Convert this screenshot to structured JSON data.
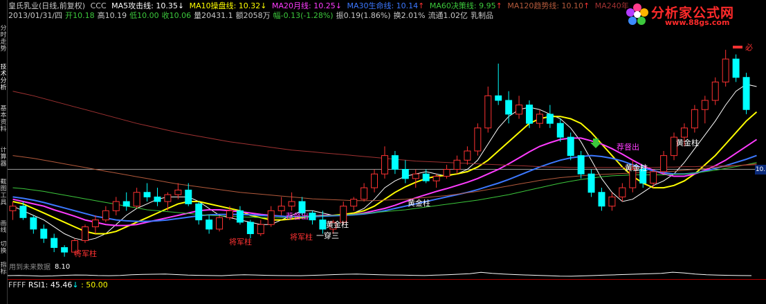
{
  "header": {
    "stock_name": "皇氏乳业(日线,前复权)",
    "formula": "CCC",
    "indicators": [
      {
        "label": "MA5攻击线: 10.35",
        "arrow": "↓",
        "color": "#ffffff"
      },
      {
        "label": "MA10操盘线: 10.32",
        "arrow": "↓",
        "color": "#ffff00"
      },
      {
        "label": "MA20月线: 10.25",
        "arrow": "↓",
        "color": "#ff3cff"
      },
      {
        "label": "MA30生命线: 10.14",
        "arrow": "↑",
        "color": "#3c78ff"
      },
      {
        "label": "MA60决策线: 9.95",
        "arrow": "↑",
        "color": "#3cc83c"
      },
      {
        "label": "MA120趋势线: 10.10",
        "arrow": "↑",
        "color": "#b45a3c"
      },
      {
        "label": "MA240年",
        "arrow": "",
        "color": "#a03232"
      }
    ],
    "quote": {
      "date": "2013/01/31/四",
      "open": "开10.18",
      "high": "高10.19",
      "low": "低10.00",
      "close": "收10.06",
      "volume": "量20431.1",
      "amount": "额2058万",
      "change": "幅-0.13(-1.28%)",
      "amplitude": "振0.19(1.86%)",
      "turnover": "换2.01%",
      "float": "流通1.02亿",
      "sector": "乳制品"
    }
  },
  "logo": {
    "title": "分析家公式网",
    "url": "www.88gs.com"
  },
  "left_tabs": [
    {
      "label": "分时走势",
      "active": false
    },
    {
      "label": "技术分析",
      "active": true
    },
    {
      "label": "基本资料",
      "active": false
    },
    {
      "label": "计算器",
      "active": false
    },
    {
      "label": "截图工具",
      "active": false
    },
    {
      "label": "画线",
      "active": false
    },
    {
      "label": "切换",
      "active": false
    },
    {
      "label": "指标",
      "active": false
    }
  ],
  "annotations": {
    "future_hint": "用到未来数据",
    "low_mark": "8.10",
    "jiangjun": "将军柱",
    "huangjin": "黄金柱",
    "chuanshan": "一穿三",
    "jiedu": "荐督出",
    "must": "必",
    "price_tag": "10."
  },
  "rsi_panel": {
    "label": "FFFF",
    "rsi_value": "RSI1: 45.46",
    "rsi_arrow": "↓",
    "level": ": 50.00"
  },
  "colors": {
    "up": "#ff3232",
    "down": "#00ffff",
    "ma5": "#ffffff",
    "ma10": "#ffff00",
    "ma20": "#ff3cff",
    "ma30": "#3c78ff",
    "ma60": "#3cc83c",
    "ma120": "#b45a3c",
    "ma240": "#a03232",
    "label_red": "#ff3232",
    "label_yellow": "#ffff00",
    "label_white": "#ffffff",
    "label_magenta": "#ff3cff",
    "header_text": "#c8c8c8"
  },
  "chart_data": {
    "type": "line",
    "title": "",
    "price_range": [
      7.9,
      12.9
    ],
    "reference_price": 10.0,
    "last_close": 10.06,
    "period_low": 8.1,
    "candles": [
      {
        "o": 9.1,
        "h": 9.3,
        "l": 8.9,
        "c": 9.2
      },
      {
        "o": 9.2,
        "h": 9.3,
        "l": 8.9,
        "c": 8.95
      },
      {
        "o": 8.95,
        "h": 9.0,
        "l": 8.6,
        "c": 8.7
      },
      {
        "o": 8.7,
        "h": 8.8,
        "l": 8.4,
        "c": 8.5
      },
      {
        "o": 8.5,
        "h": 8.6,
        "l": 8.2,
        "c": 8.3
      },
      {
        "o": 8.3,
        "h": 8.35,
        "l": 8.1,
        "c": 8.2
      },
      {
        "o": 8.2,
        "h": 8.5,
        "l": 8.15,
        "c": 8.45
      },
      {
        "o": 8.45,
        "h": 8.8,
        "l": 8.4,
        "c": 8.75
      },
      {
        "o": 8.75,
        "h": 9.0,
        "l": 8.6,
        "c": 8.9
      },
      {
        "o": 8.9,
        "h": 9.2,
        "l": 8.85,
        "c": 9.1
      },
      {
        "o": 9.1,
        "h": 9.4,
        "l": 9.0,
        "c": 9.3
      },
      {
        "o": 9.3,
        "h": 9.5,
        "l": 9.1,
        "c": 9.2
      },
      {
        "o": 9.2,
        "h": 9.6,
        "l": 9.15,
        "c": 9.5
      },
      {
        "o": 9.5,
        "h": 9.7,
        "l": 9.3,
        "c": 9.4
      },
      {
        "o": 9.4,
        "h": 9.6,
        "l": 9.2,
        "c": 9.3
      },
      {
        "o": 9.3,
        "h": 9.5,
        "l": 9.1,
        "c": 9.45
      },
      {
        "o": 9.45,
        "h": 9.7,
        "l": 9.35,
        "c": 9.55
      },
      {
        "o": 9.55,
        "h": 9.7,
        "l": 9.2,
        "c": 9.25
      },
      {
        "o": 9.25,
        "h": 9.3,
        "l": 8.8,
        "c": 8.9
      },
      {
        "o": 8.9,
        "h": 9.0,
        "l": 8.6,
        "c": 8.7
      },
      {
        "o": 8.7,
        "h": 9.0,
        "l": 8.65,
        "c": 8.95
      },
      {
        "o": 8.95,
        "h": 9.2,
        "l": 8.9,
        "c": 9.1
      },
      {
        "o": 9.1,
        "h": 9.2,
        "l": 8.8,
        "c": 8.85
      },
      {
        "o": 8.85,
        "h": 8.9,
        "l": 8.5,
        "c": 8.6
      },
      {
        "o": 8.6,
        "h": 8.9,
        "l": 8.55,
        "c": 8.8
      },
      {
        "o": 8.8,
        "h": 9.2,
        "l": 8.75,
        "c": 9.1
      },
      {
        "o": 9.1,
        "h": 9.4,
        "l": 9.0,
        "c": 9.2
      },
      {
        "o": 9.2,
        "h": 9.5,
        "l": 9.1,
        "c": 9.3
      },
      {
        "o": 9.3,
        "h": 9.4,
        "l": 9.0,
        "c": 9.05
      },
      {
        "o": 9.05,
        "h": 9.1,
        "l": 8.8,
        "c": 8.9
      },
      {
        "o": 8.9,
        "h": 9.1,
        "l": 8.6,
        "c": 8.7
      },
      {
        "o": 8.7,
        "h": 8.9,
        "l": 8.6,
        "c": 8.85
      },
      {
        "o": 8.85,
        "h": 9.3,
        "l": 8.8,
        "c": 9.2
      },
      {
        "o": 9.2,
        "h": 9.4,
        "l": 9.1,
        "c": 9.35
      },
      {
        "o": 9.35,
        "h": 9.7,
        "l": 9.3,
        "c": 9.6
      },
      {
        "o": 9.6,
        "h": 10.0,
        "l": 9.5,
        "c": 9.9
      },
      {
        "o": 9.9,
        "h": 10.5,
        "l": 9.8,
        "c": 10.3
      },
      {
        "o": 10.3,
        "h": 10.4,
        "l": 9.9,
        "c": 10.0
      },
      {
        "o": 10.0,
        "h": 10.2,
        "l": 9.7,
        "c": 9.8
      },
      {
        "o": 9.8,
        "h": 10.0,
        "l": 9.6,
        "c": 9.9
      },
      {
        "o": 9.9,
        "h": 10.0,
        "l": 9.7,
        "c": 9.75
      },
      {
        "o": 9.75,
        "h": 9.9,
        "l": 9.6,
        "c": 9.85
      },
      {
        "o": 9.85,
        "h": 10.1,
        "l": 9.8,
        "c": 10.0
      },
      {
        "o": 10.0,
        "h": 10.3,
        "l": 9.9,
        "c": 10.2
      },
      {
        "o": 10.2,
        "h": 10.5,
        "l": 10.1,
        "c": 10.4
      },
      {
        "o": 10.4,
        "h": 11.0,
        "l": 10.3,
        "c": 10.9
      },
      {
        "o": 10.9,
        "h": 11.8,
        "l": 10.8,
        "c": 11.6
      },
      {
        "o": 11.6,
        "h": 12.3,
        "l": 11.4,
        "c": 11.5
      },
      {
        "o": 11.5,
        "h": 11.7,
        "l": 11.0,
        "c": 11.2
      },
      {
        "o": 11.2,
        "h": 11.6,
        "l": 11.1,
        "c": 11.4
      },
      {
        "o": 11.4,
        "h": 11.5,
        "l": 10.9,
        "c": 11.0
      },
      {
        "o": 11.0,
        "h": 11.3,
        "l": 10.9,
        "c": 11.2
      },
      {
        "o": 11.2,
        "h": 11.4,
        "l": 10.9,
        "c": 11.0
      },
      {
        "o": 11.0,
        "h": 11.1,
        "l": 10.6,
        "c": 10.7
      },
      {
        "o": 10.7,
        "h": 10.8,
        "l": 10.2,
        "c": 10.3
      },
      {
        "o": 10.3,
        "h": 10.4,
        "l": 9.8,
        "c": 9.9
      },
      {
        "o": 9.9,
        "h": 10.0,
        "l": 9.4,
        "c": 9.5
      },
      {
        "o": 9.5,
        "h": 9.6,
        "l": 9.1,
        "c": 9.2
      },
      {
        "o": 9.2,
        "h": 9.5,
        "l": 9.1,
        "c": 9.4
      },
      {
        "o": 9.4,
        "h": 9.7,
        "l": 9.3,
        "c": 9.6
      },
      {
        "o": 9.6,
        "h": 10.2,
        "l": 9.5,
        "c": 10.0
      },
      {
        "o": 10.0,
        "h": 10.1,
        "l": 9.6,
        "c": 9.7
      },
      {
        "o": 9.7,
        "h": 10.0,
        "l": 9.6,
        "c": 9.95
      },
      {
        "o": 9.95,
        "h": 10.4,
        "l": 9.9,
        "c": 10.3
      },
      {
        "o": 10.3,
        "h": 10.8,
        "l": 10.2,
        "c": 10.7
      },
      {
        "o": 10.7,
        "h": 11.0,
        "l": 10.5,
        "c": 10.9
      },
      {
        "o": 10.9,
        "h": 11.4,
        "l": 10.8,
        "c": 11.3
      },
      {
        "o": 11.3,
        "h": 11.6,
        "l": 11.0,
        "c": 11.5
      },
      {
        "o": 11.5,
        "h": 12.0,
        "l": 11.4,
        "c": 11.9
      },
      {
        "o": 11.9,
        "h": 12.6,
        "l": 11.8,
        "c": 12.4
      },
      {
        "o": 12.4,
        "h": 12.5,
        "l": 11.9,
        "c": 12.0
      },
      {
        "o": 12.0,
        "h": 12.1,
        "l": 11.2,
        "c": 11.3
      }
    ],
    "ma_series": [
      {
        "name": "MA5攻击线",
        "values": [
          9.2,
          9.1,
          9.0,
          8.9,
          8.75,
          8.6,
          8.5,
          8.45,
          8.5,
          8.6,
          8.8,
          9.0,
          9.15,
          9.25,
          9.35,
          9.4,
          9.4,
          9.4,
          9.3,
          9.15,
          9.0,
          8.95,
          8.9,
          8.85,
          8.8,
          8.8,
          8.9,
          9.0,
          9.1,
          9.1,
          9.05,
          9.0,
          9.0,
          9.05,
          9.15,
          9.35,
          9.6,
          9.75,
          9.85,
          9.9,
          9.95,
          9.9,
          9.85,
          9.9,
          10.0,
          10.2,
          10.55,
          10.9,
          11.15,
          11.3,
          11.35,
          11.3,
          11.2,
          11.1,
          10.9,
          10.6,
          10.2,
          9.8,
          9.5,
          9.3,
          9.35,
          9.5,
          9.65,
          9.75,
          9.9,
          10.15,
          10.45,
          10.75,
          11.05,
          11.4,
          11.7,
          11.85,
          11.8
        ]
      },
      {
        "name": "MA10操盘线",
        "values": [
          9.3,
          9.25,
          9.15,
          9.05,
          8.95,
          8.85,
          8.75,
          8.65,
          8.6,
          8.6,
          8.65,
          8.75,
          8.85,
          8.95,
          9.05,
          9.15,
          9.25,
          9.3,
          9.3,
          9.25,
          9.2,
          9.15,
          9.1,
          9.0,
          8.95,
          8.9,
          8.9,
          8.92,
          8.95,
          8.98,
          9.0,
          9.0,
          9.02,
          9.05,
          9.1,
          9.2,
          9.35,
          9.5,
          9.62,
          9.72,
          9.8,
          9.85,
          9.87,
          9.9,
          9.95,
          10.05,
          10.2,
          10.4,
          10.6,
          10.8,
          11.0,
          11.1,
          11.15,
          11.15,
          11.1,
          11.0,
          10.8,
          10.55,
          10.3,
          10.05,
          9.85,
          9.7,
          9.6,
          9.6,
          9.65,
          9.75,
          9.9,
          10.1,
          10.3,
          10.55,
          10.8,
          11.05,
          11.25
        ]
      },
      {
        "name": "MA20月线",
        "values": [
          9.35,
          9.3,
          9.25,
          9.2,
          9.12,
          9.05,
          8.98,
          8.9,
          8.85,
          8.8,
          8.78,
          8.78,
          8.8,
          8.85,
          8.9,
          8.95,
          9.0,
          9.05,
          9.1,
          9.12,
          9.12,
          9.1,
          9.08,
          9.05,
          9.02,
          9.0,
          8.98,
          8.97,
          8.97,
          8.98,
          9.0,
          9.0,
          9.0,
          9.02,
          9.05,
          9.1,
          9.15,
          9.22,
          9.3,
          9.38,
          9.45,
          9.52,
          9.58,
          9.65,
          9.72,
          9.8,
          9.9,
          10.0,
          10.12,
          10.25,
          10.38,
          10.5,
          10.58,
          10.65,
          10.68,
          10.68,
          10.62,
          10.55,
          10.45,
          10.33,
          10.2,
          10.08,
          9.98,
          9.9,
          9.85,
          9.85,
          9.9,
          9.98,
          10.08,
          10.2,
          10.35,
          10.5,
          10.65
        ]
      },
      {
        "name": "MA30生命线",
        "values": [
          9.4,
          9.37,
          9.33,
          9.28,
          9.22,
          9.16,
          9.1,
          9.04,
          8.98,
          8.94,
          8.9,
          8.88,
          8.87,
          8.87,
          8.88,
          8.9,
          8.93,
          8.96,
          8.99,
          9.01,
          9.02,
          9.02,
          9.02,
          9.01,
          9.0,
          8.99,
          8.98,
          8.97,
          8.97,
          8.97,
          8.98,
          8.99,
          9.0,
          9.01,
          9.03,
          9.06,
          9.1,
          9.15,
          9.2,
          9.25,
          9.3,
          9.35,
          9.4,
          9.45,
          9.5,
          9.56,
          9.63,
          9.7,
          9.78,
          9.87,
          9.96,
          10.05,
          10.13,
          10.2,
          10.25,
          10.28,
          10.3,
          10.28,
          10.24,
          10.18,
          10.1,
          10.03,
          9.97,
          9.93,
          9.9,
          9.9,
          9.92,
          9.96,
          10.02,
          10.08,
          10.15,
          10.22,
          10.3
        ]
      },
      {
        "name": "MA60决策线",
        "values": [
          9.6,
          9.58,
          9.55,
          9.52,
          9.48,
          9.44,
          9.4,
          9.36,
          9.32,
          9.28,
          9.24,
          9.2,
          9.16,
          9.12,
          9.1,
          9.08,
          9.06,
          9.04,
          9.02,
          9.0,
          8.99,
          8.98,
          8.97,
          8.96,
          8.95,
          8.95,
          8.95,
          8.96,
          8.97,
          8.98,
          8.99,
          9.0,
          9.01,
          9.02,
          9.04,
          9.06,
          9.08,
          9.1,
          9.12,
          9.15,
          9.18,
          9.21,
          9.24,
          9.27,
          9.3,
          9.33,
          9.37,
          9.41,
          9.45,
          9.5,
          9.55,
          9.6,
          9.65,
          9.7,
          9.74,
          9.78,
          9.81,
          9.84,
          9.86,
          9.87,
          9.88,
          9.88,
          9.88,
          9.88,
          9.89,
          9.9,
          9.92,
          9.95,
          9.98,
          10.02,
          10.06,
          10.1,
          10.15
        ]
      },
      {
        "name": "MA120趋势线",
        "values": [
          10.3,
          10.27,
          10.24,
          10.2,
          10.16,
          10.12,
          10.08,
          10.04,
          10.0,
          9.96,
          9.92,
          9.88,
          9.84,
          9.8,
          9.76,
          9.72,
          9.68,
          9.65,
          9.62,
          9.59,
          9.56,
          9.53,
          9.5,
          9.48,
          9.46,
          9.44,
          9.42,
          9.4,
          9.38,
          9.36,
          9.35,
          9.34,
          9.33,
          9.32,
          9.32,
          9.32,
          9.33,
          9.34,
          9.35,
          9.37,
          9.39,
          9.41,
          9.43,
          9.46,
          9.49,
          9.52,
          9.56,
          9.6,
          9.64,
          9.68,
          9.72,
          9.76,
          9.79,
          9.82,
          9.84,
          9.86,
          9.88,
          9.89,
          9.9,
          9.91,
          9.92,
          9.93,
          9.94,
          9.95,
          9.96,
          9.98,
          10.0,
          10.02,
          10.04,
          10.06,
          10.08,
          10.1,
          10.12
        ]
      },
      {
        "name": "MA240年",
        "values": [
          11.7,
          11.65,
          11.6,
          11.54,
          11.48,
          11.42,
          11.36,
          11.3,
          11.24,
          11.18,
          11.12,
          11.06,
          11.0,
          10.95,
          10.9,
          10.85,
          10.8,
          10.76,
          10.72,
          10.68,
          10.64,
          10.6,
          10.57,
          10.54,
          10.51,
          10.48,
          10.45,
          10.42,
          10.4,
          10.38,
          10.36,
          10.34,
          10.32,
          10.3,
          10.28,
          10.26,
          10.24,
          10.22,
          10.2,
          10.18,
          10.17,
          10.16,
          10.15,
          10.14,
          10.13,
          10.12,
          10.11,
          10.1,
          10.09,
          10.08,
          10.07,
          10.06,
          10.05,
          10.05,
          10.04,
          10.04,
          10.04,
          10.04,
          10.04,
          10.04,
          10.04,
          10.04,
          10.04,
          10.05,
          10.05,
          10.06,
          10.06,
          10.07,
          10.07,
          10.08,
          10.08,
          10.09,
          10.1
        ]
      }
    ],
    "rsi_values": [
      45,
      47,
      44,
      40,
      42,
      48,
      52,
      50,
      46,
      44,
      47,
      55,
      58,
      60,
      62,
      56,
      50,
      48,
      46,
      44,
      50,
      54,
      52,
      48,
      46,
      45,
      44,
      48,
      52,
      56,
      60,
      62,
      58,
      55,
      52,
      50,
      48,
      46,
      50,
      54,
      60,
      66,
      80,
      70,
      62,
      56,
      52,
      48,
      44,
      40,
      38,
      42,
      46,
      50,
      54,
      58,
      62,
      66,
      70,
      82,
      74,
      62,
      55,
      50,
      48,
      46,
      45
    ]
  }
}
